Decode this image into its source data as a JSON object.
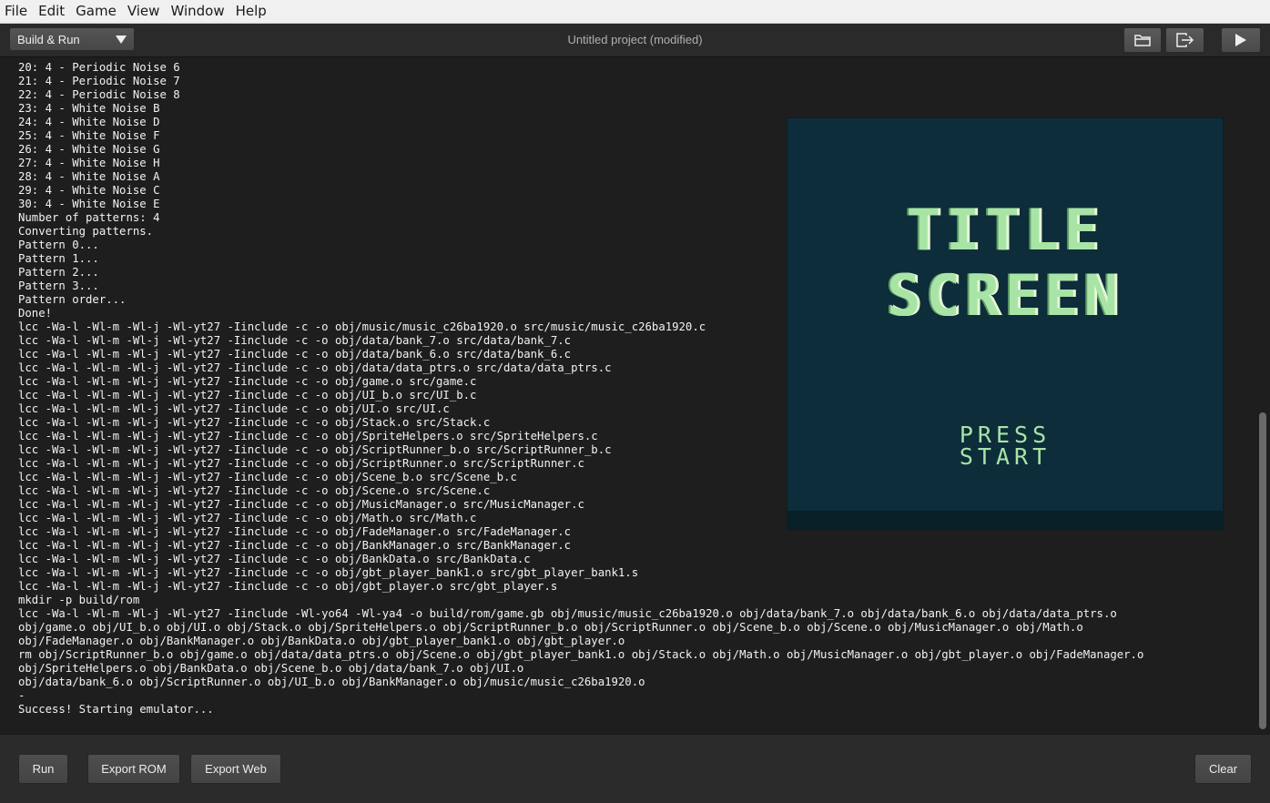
{
  "menu": [
    "File",
    "Edit",
    "Game",
    "View",
    "Window",
    "Help"
  ],
  "toolbar": {
    "build_mode": "Build & Run",
    "project_title": "Untitled project (modified)",
    "icons": [
      "folder-open-icon",
      "export-icon",
      "play-icon"
    ]
  },
  "console": {
    "lines": [
      "20: 4 - Periodic Noise 6",
      "21: 4 - Periodic Noise 7",
      "22: 4 - Periodic Noise 8",
      "23: 4 - White Noise B",
      "24: 4 - White Noise D",
      "25: 4 - White Noise F",
      "26: 4 - White Noise G",
      "27: 4 - White Noise H",
      "28: 4 - White Noise A",
      "29: 4 - White Noise C",
      "30: 4 - White Noise E",
      "Number of patterns: 4",
      "Converting patterns.",
      "Pattern 0...",
      "Pattern 1...",
      "Pattern 2...",
      "Pattern 3...",
      "Pattern order...",
      "Done!",
      "lcc -Wa-l -Wl-m -Wl-j -Wl-yt27 -Iinclude -c -o obj/music/music_c26ba1920.o src/music/music_c26ba1920.c",
      "lcc -Wa-l -Wl-m -Wl-j -Wl-yt27 -Iinclude -c -o obj/data/bank_7.o src/data/bank_7.c",
      "lcc -Wa-l -Wl-m -Wl-j -Wl-yt27 -Iinclude -c -o obj/data/bank_6.o src/data/bank_6.c",
      "lcc -Wa-l -Wl-m -Wl-j -Wl-yt27 -Iinclude -c -o obj/data/data_ptrs.o src/data/data_ptrs.c",
      "lcc -Wa-l -Wl-m -Wl-j -Wl-yt27 -Iinclude -c -o obj/game.o src/game.c",
      "lcc -Wa-l -Wl-m -Wl-j -Wl-yt27 -Iinclude -c -o obj/UI_b.o src/UI_b.c",
      "lcc -Wa-l -Wl-m -Wl-j -Wl-yt27 -Iinclude -c -o obj/UI.o src/UI.c",
      "lcc -Wa-l -Wl-m -Wl-j -Wl-yt27 -Iinclude -c -o obj/Stack.o src/Stack.c",
      "lcc -Wa-l -Wl-m -Wl-j -Wl-yt27 -Iinclude -c -o obj/SpriteHelpers.o src/SpriteHelpers.c",
      "lcc -Wa-l -Wl-m -Wl-j -Wl-yt27 -Iinclude -c -o obj/ScriptRunner_b.o src/ScriptRunner_b.c",
      "lcc -Wa-l -Wl-m -Wl-j -Wl-yt27 -Iinclude -c -o obj/ScriptRunner.o src/ScriptRunner.c",
      "lcc -Wa-l -Wl-m -Wl-j -Wl-yt27 -Iinclude -c -o obj/Scene_b.o src/Scene_b.c",
      "lcc -Wa-l -Wl-m -Wl-j -Wl-yt27 -Iinclude -c -o obj/Scene.o src/Scene.c",
      "lcc -Wa-l -Wl-m -Wl-j -Wl-yt27 -Iinclude -c -o obj/MusicManager.o src/MusicManager.c",
      "lcc -Wa-l -Wl-m -Wl-j -Wl-yt27 -Iinclude -c -o obj/Math.o src/Math.c",
      "lcc -Wa-l -Wl-m -Wl-j -Wl-yt27 -Iinclude -c -o obj/FadeManager.o src/FadeManager.c",
      "lcc -Wa-l -Wl-m -Wl-j -Wl-yt27 -Iinclude -c -o obj/BankManager.o src/BankManager.c",
      "lcc -Wa-l -Wl-m -Wl-j -Wl-yt27 -Iinclude -c -o obj/BankData.o src/BankData.c",
      "lcc -Wa-l -Wl-m -Wl-j -Wl-yt27 -Iinclude -c -o obj/gbt_player_bank1.o src/gbt_player_bank1.s",
      "lcc -Wa-l -Wl-m -Wl-j -Wl-yt27 -Iinclude -c -o obj/gbt_player.o src/gbt_player.s",
      "mkdir -p build/rom",
      "lcc -Wa-l -Wl-m -Wl-j -Wl-yt27 -Iinclude -Wl-yo64 -Wl-ya4 -o build/rom/game.gb obj/music/music_c26ba1920.o obj/data/bank_7.o obj/data/bank_6.o obj/data/data_ptrs.o",
      "obj/game.o obj/UI_b.o obj/UI.o obj/Stack.o obj/SpriteHelpers.o obj/ScriptRunner_b.o obj/ScriptRunner.o obj/Scene_b.o obj/Scene.o obj/MusicManager.o obj/Math.o",
      "obj/FadeManager.o obj/BankManager.o obj/BankData.o obj/gbt_player_bank1.o obj/gbt_player.o",
      "rm obj/ScriptRunner_b.o obj/game.o obj/data/data_ptrs.o obj/Scene.o obj/gbt_player_bank1.o obj/Stack.o obj/Math.o obj/MusicManager.o obj/gbt_player.o obj/FadeManager.o",
      "obj/SpriteHelpers.o obj/BankData.o obj/Scene_b.o obj/data/bank_7.o obj/UI.o",
      "obj/data/bank_6.o obj/ScriptRunner.o obj/UI_b.o obj/BankManager.o obj/music/music_c26ba1920.o",
      "-",
      "Success! Starting emulator..."
    ]
  },
  "game_screen": {
    "title_line1": "TITLE",
    "title_line2": "SCREEN",
    "press_line1": "PRESS",
    "press_line2": "START",
    "bg_color": "#0d2d3a",
    "text_color": "#a8e4a6"
  },
  "footer": {
    "run_label": "Run",
    "export_rom_label": "Export ROM",
    "export_web_label": "Export Web",
    "clear_label": "Clear"
  }
}
